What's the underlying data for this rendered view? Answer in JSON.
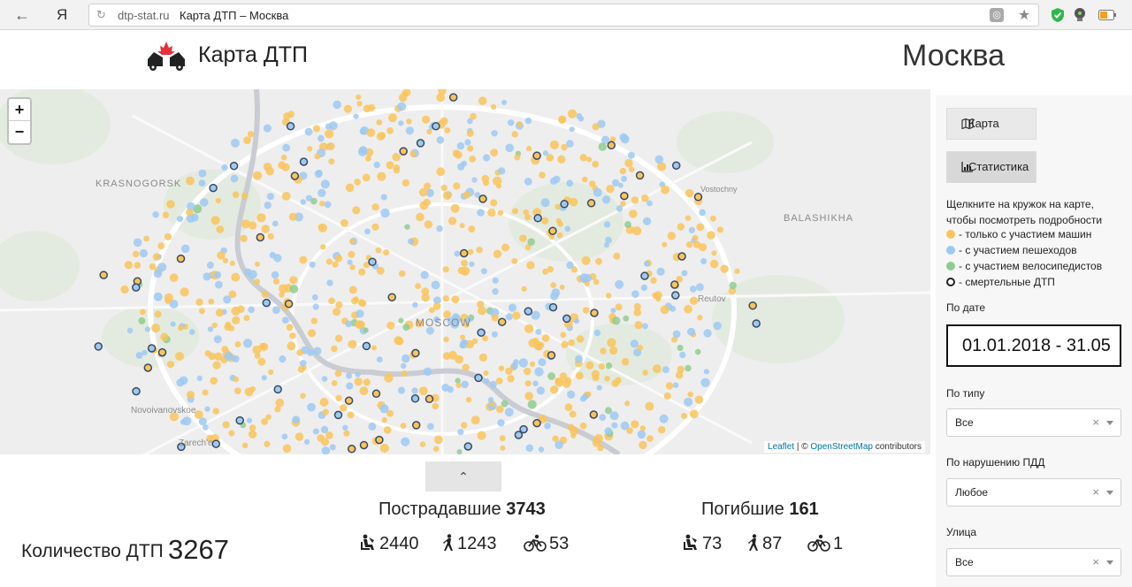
{
  "browser": {
    "ya": "Я",
    "domain": "dtp-stat.ru",
    "page_title": "Карта ДТП – Москва"
  },
  "header": {
    "logo_text": "Карта ДТП",
    "city": "Москва"
  },
  "map": {
    "zoom_in": "+",
    "zoom_out": "−",
    "labels": {
      "krasnogorsk": "KRASNOGORSK",
      "balashikha": "BALASHIKHA",
      "moscow": "MOSCOW",
      "reutov": "Reutov",
      "vostochny": "Vostochny",
      "novoivanovskoe": "Novoivanovskoe",
      "zarechye": "Zarech'e"
    },
    "attribution": {
      "leaflet": "Leaflet",
      "sep": " | © ",
      "osm": "OpenStreetMap",
      "contributors": " contributors"
    },
    "colors": {
      "cars": "#f9c45c",
      "pedestrians": "#9ec9f2",
      "cyclists": "#8fcc8f",
      "fatal_ring": "#3a4a60"
    }
  },
  "stats": {
    "collapse_icon": "chevron-up",
    "collapse_glyph": "⌃",
    "count_label": "Количество ДТП",
    "count_value": "3267",
    "injured_label": "Пострадавшие",
    "injured_total": "3743",
    "injured_drivers": "2440",
    "injured_pedestrians": "1243",
    "injured_cyclists": "53",
    "dead_label": "Погибшие",
    "dead_total": "161",
    "dead_drivers": "73",
    "dead_pedestrians": "87",
    "dead_cyclists": "1"
  },
  "sidebar": {
    "map_button": "Карта",
    "stats_button": "Статистика",
    "hint_line1": "Щелкните на кружок на карте,",
    "hint_line2": "чтобы посмотреть подробности",
    "legend": [
      {
        "color": "#f9c45c",
        "label": "- только с участием машин",
        "ring": false
      },
      {
        "color": "#9ec9f2",
        "label": "- с участием пешеходов",
        "ring": false
      },
      {
        "color": "#8fcc8f",
        "label": "- с участием велосипедистов",
        "ring": false
      },
      {
        "color": "#ffffff",
        "label": "- смертельные ДТП",
        "ring": true
      }
    ],
    "date_label": "По дате",
    "date_value": "01.01.2018 - 31.05",
    "type_label": "По типу",
    "type_value": "Все",
    "violation_label": "По нарушению ПДД",
    "violation_value": "Любое",
    "street_label": "Улица",
    "street_value": "Все",
    "clear_glyph": "×"
  }
}
